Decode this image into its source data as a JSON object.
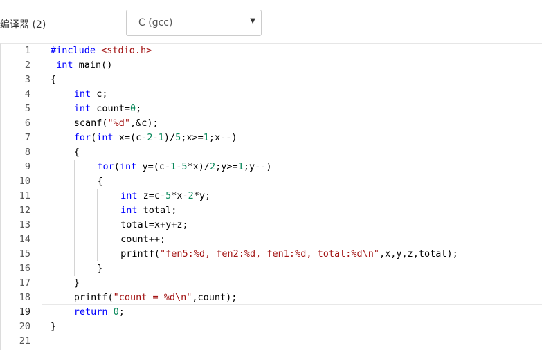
{
  "toolbar": {
    "compiler_label": "编译器 (2)",
    "compiler_selected": "C (gcc)"
  },
  "editor": {
    "lines": [
      {
        "n": "1",
        "indent": 0,
        "tokens": [
          [
            "#include ",
            "kw"
          ],
          [
            "<stdio.h>",
            "str"
          ]
        ]
      },
      {
        "n": "2",
        "indent": 0,
        "tokens": [
          [
            " int",
            "kw"
          ],
          [
            " main()",
            ""
          ]
        ]
      },
      {
        "n": "3",
        "indent": 0,
        "tokens": [
          [
            "{",
            ""
          ]
        ]
      },
      {
        "n": "4",
        "indent": 1,
        "tokens": [
          [
            "int",
            "kw"
          ],
          [
            " c;",
            ""
          ]
        ]
      },
      {
        "n": "5",
        "indent": 1,
        "tokens": [
          [
            "int",
            "kw"
          ],
          [
            " count=",
            ""
          ],
          [
            "0",
            "num"
          ],
          [
            ";",
            ""
          ]
        ]
      },
      {
        "n": "6",
        "indent": 1,
        "tokens": [
          [
            "scanf(",
            ""
          ],
          [
            "\"%d\"",
            "str"
          ],
          [
            ",&c);",
            ""
          ]
        ]
      },
      {
        "n": "7",
        "indent": 1,
        "tokens": [
          [
            "for",
            "kw"
          ],
          [
            "(",
            ""
          ],
          [
            "int",
            "kw"
          ],
          [
            " x=(c-",
            ""
          ],
          [
            "2",
            "num"
          ],
          [
            "-",
            ""
          ],
          [
            "1",
            "num"
          ],
          [
            ")/",
            ""
          ],
          [
            "5",
            "num"
          ],
          [
            ";x>=",
            ""
          ],
          [
            "1",
            "num"
          ],
          [
            ";x--)",
            ""
          ]
        ]
      },
      {
        "n": "8",
        "indent": 1,
        "tokens": [
          [
            "{",
            ""
          ]
        ]
      },
      {
        "n": "9",
        "indent": 2,
        "tokens": [
          [
            "for",
            "kw"
          ],
          [
            "(",
            ""
          ],
          [
            "int",
            "kw"
          ],
          [
            " y=(c-",
            ""
          ],
          [
            "1",
            "num"
          ],
          [
            "-",
            ""
          ],
          [
            "5",
            "num"
          ],
          [
            "*x)/",
            ""
          ],
          [
            "2",
            "num"
          ],
          [
            ";y>=",
            ""
          ],
          [
            "1",
            "num"
          ],
          [
            ";y--)",
            ""
          ]
        ]
      },
      {
        "n": "10",
        "indent": 2,
        "tokens": [
          [
            "{",
            ""
          ]
        ]
      },
      {
        "n": "11",
        "indent": 3,
        "tokens": [
          [
            "int",
            "kw"
          ],
          [
            " z=c-",
            ""
          ],
          [
            "5",
            "num"
          ],
          [
            "*x-",
            ""
          ],
          [
            "2",
            "num"
          ],
          [
            "*y;",
            ""
          ]
        ]
      },
      {
        "n": "12",
        "indent": 3,
        "tokens": [
          [
            "int",
            "kw"
          ],
          [
            " total;",
            ""
          ]
        ]
      },
      {
        "n": "13",
        "indent": 3,
        "tokens": [
          [
            "total=x+y+z;",
            ""
          ]
        ]
      },
      {
        "n": "14",
        "indent": 3,
        "tokens": [
          [
            "count++;",
            ""
          ]
        ]
      },
      {
        "n": "15",
        "indent": 3,
        "tokens": [
          [
            "printf(",
            ""
          ],
          [
            "\"fen5:%d, fen2:%d, fen1:%d, total:%d\\n\"",
            "str"
          ],
          [
            ",x,y,z,total);",
            ""
          ]
        ]
      },
      {
        "n": "16",
        "indent": 2,
        "tokens": [
          [
            "}",
            ""
          ]
        ]
      },
      {
        "n": "17",
        "indent": 1,
        "tokens": [
          [
            "}",
            ""
          ]
        ]
      },
      {
        "n": "18",
        "indent": 1,
        "tokens": [
          [
            "printf(",
            ""
          ],
          [
            "\"count = %d\\n\"",
            "str"
          ],
          [
            ",count);",
            ""
          ]
        ]
      },
      {
        "n": "19",
        "indent": 1,
        "tokens": [
          [
            "return",
            "kw"
          ],
          [
            " ",
            ""
          ],
          [
            "0",
            "num"
          ],
          [
            ";",
            ""
          ]
        ]
      },
      {
        "n": "20",
        "indent": 0,
        "tokens": [
          [
            "}",
            ""
          ]
        ]
      },
      {
        "n": "21",
        "indent": 0,
        "tokens": []
      }
    ],
    "active_line": "19"
  }
}
